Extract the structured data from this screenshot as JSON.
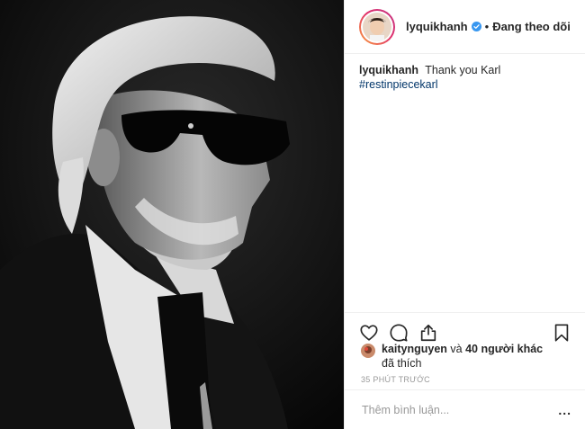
{
  "post": {
    "image_alt": "Black and white portrait photo"
  },
  "header": {
    "username": "lyquikhanh",
    "separator": "•",
    "follow_state": "Đang theo dõi"
  },
  "caption": {
    "username": "lyquikhanh",
    "text": "Thank you Karl",
    "hashtag": "#restinpiecekarl"
  },
  "actions": {
    "icons": [
      "heart-icon",
      "comment-icon",
      "share-icon",
      "bookmark-icon"
    ]
  },
  "likes": {
    "first_user": "kaitynguyen",
    "connector": "và",
    "others": "40 người khác",
    "suffix": "đã thích"
  },
  "timestamp": "35 PHÚT TRƯỚC",
  "comment": {
    "placeholder": "Thêm bình luận...",
    "more_icon": "..."
  },
  "colors": {
    "verified": "#3897f0",
    "hashtag": "#003569",
    "border": "#efefef",
    "muted": "#999999"
  }
}
